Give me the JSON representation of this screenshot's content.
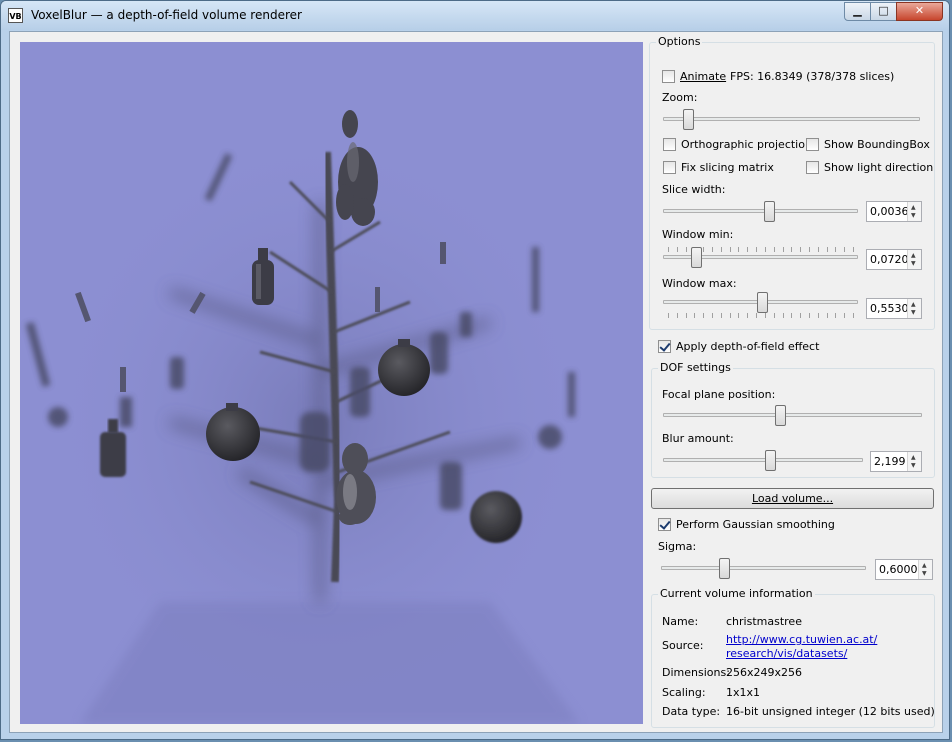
{
  "window": {
    "app_icon": "VB",
    "title": "VoxelBlur — a depth-of-field volume renderer",
    "controls": {
      "minimize": "▁",
      "maximize": "□",
      "close": "✕"
    }
  },
  "options": {
    "title": "Options",
    "animate": {
      "label": "Animate",
      "checked": false
    },
    "fps_text": "FPS: 16.8349 (378/378 slices)",
    "zoom": {
      "label": "Zoom:",
      "level": 0.08
    },
    "orthographic": {
      "label": "Orthographic projection",
      "checked": false
    },
    "show_bbox": {
      "label": "Show BoundingBox",
      "checked": false
    },
    "fix_slicing": {
      "label": "Fix slicing matrix",
      "checked": false
    },
    "show_light": {
      "label": "Show light direction",
      "checked": false
    },
    "slice_width": {
      "label": "Slice width:",
      "value": "0,0036",
      "level": 0.55
    },
    "window_min": {
      "label": "Window min:",
      "value": "0,0720",
      "level": 0.15
    },
    "window_max": {
      "label": "Window max:",
      "value": "0,5530",
      "level": 0.51
    }
  },
  "dof": {
    "apply": {
      "label": "Apply depth-of-field effect",
      "checked": true
    },
    "title": "DOF settings",
    "focal": {
      "label": "Focal plane position:",
      "level": 0.45
    },
    "blur": {
      "label": "Blur amount:",
      "value": "2,199",
      "level": 0.54
    }
  },
  "load_button": "Load volume...",
  "gaussian": {
    "label": "Perform Gaussian smoothing",
    "checked": true
  },
  "sigma": {
    "label": "Sigma:",
    "value": "0,6000",
    "level": 0.3
  },
  "info": {
    "title": "Current volume information",
    "name_label": "Name:",
    "name_value": "christmastree",
    "source_label": "Source:",
    "source_line1": "http://www.cg.tuwien.ac.at/",
    "source_line2": "research/vis/datasets/",
    "dimensions_label": "Dimensions:",
    "dimensions_value": "256x249x256",
    "scaling_label": "Scaling:",
    "scaling_value": "1x1x1",
    "datatype_label": "Data type:",
    "datatype_value": "16-bit unsigned integer (12 bits used)"
  },
  "colors": {
    "viewport_bg": "#8c8fd2",
    "object_dark": "#3c3c46",
    "link": "#0000cc"
  }
}
